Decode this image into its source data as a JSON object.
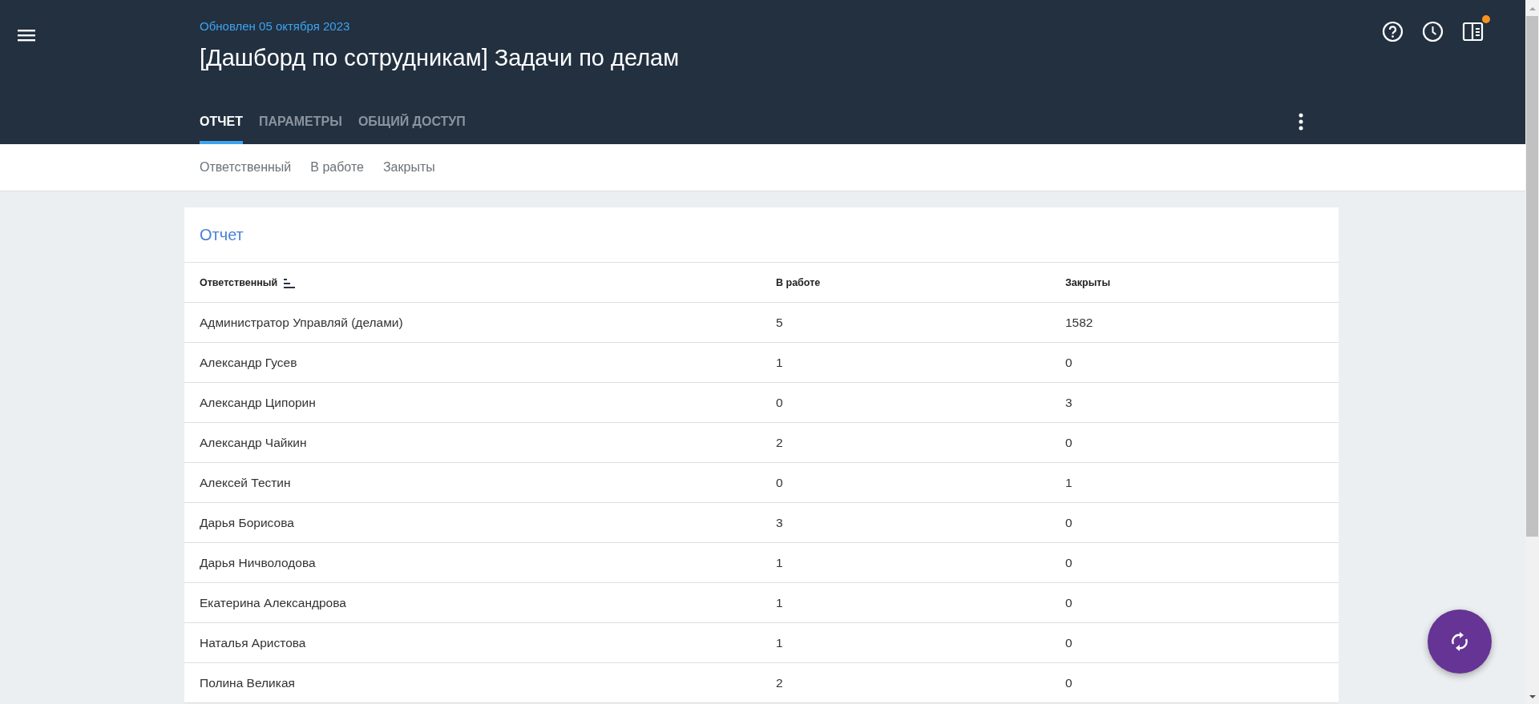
{
  "header": {
    "updated": "Обновлен 05 октября 2023",
    "title": "[Дашборд по сотрудникам] Задачи по делам",
    "notification": true
  },
  "tabs": [
    {
      "label": "ОТЧЕТ",
      "selected": true
    },
    {
      "label": "ПАРАМЕТРЫ",
      "selected": false
    },
    {
      "label": "ОБЩИЙ ДОСТУП",
      "selected": false
    }
  ],
  "subnav": [
    "Ответственный",
    "В работе",
    "Закрыты"
  ],
  "report": {
    "title": "Отчет",
    "columns": [
      {
        "label": "Ответственный",
        "sorted": true
      },
      {
        "label": "В работе",
        "sorted": false
      },
      {
        "label": "Закрыты",
        "sorted": false
      }
    ],
    "rows": [
      [
        "Администратор Управляй (делами)",
        "5",
        "1582"
      ],
      [
        "Александр Гусев",
        "1",
        "0"
      ],
      [
        "Александр Ципорин",
        "0",
        "3"
      ],
      [
        "Александр Чайкин",
        "2",
        "0"
      ],
      [
        "Алексей Тестин",
        "0",
        "1"
      ],
      [
        "Дарья Борисова",
        "3",
        "0"
      ],
      [
        "Дарья Ничволодова",
        "1",
        "0"
      ],
      [
        "Екатерина Александрова",
        "1",
        "0"
      ],
      [
        "Наталья Аристова",
        "1",
        "0"
      ],
      [
        "Полина Великая",
        "2",
        "0"
      ]
    ]
  }
}
